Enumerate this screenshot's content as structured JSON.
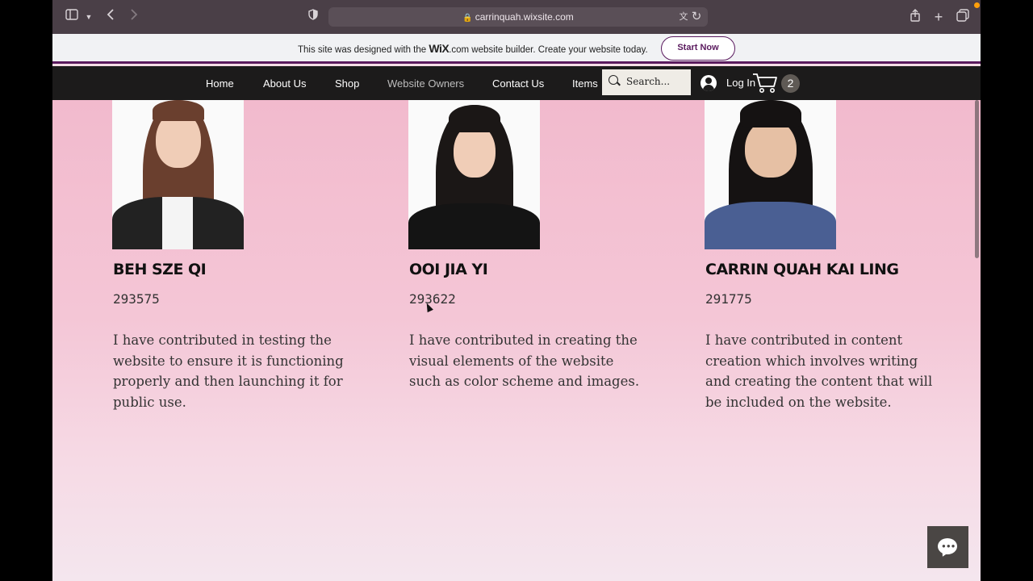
{
  "browser": {
    "url": "carrinquah.wixsite.com",
    "icons": [
      "sidebar-icon",
      "chevron-down-icon",
      "back-icon",
      "forward-icon",
      "shield-icon",
      "lock-icon",
      "translate-icon",
      "reload-icon",
      "share-icon",
      "plus-icon",
      "tabs-icon"
    ]
  },
  "wix_banner": {
    "text_before": "This site was designed with the ",
    "logo": "WiX",
    "text_after": ".com website builder. Create your website today.",
    "button": "Start Now",
    "accent": "#5a1a5e"
  },
  "nav": {
    "items": [
      "Home",
      "About Us",
      "Shop",
      "Website Owners",
      "Contact Us",
      "Items"
    ],
    "active_item": "Website Owners",
    "search_placeholder": "Search...",
    "login": "Log In",
    "cart_count": "2"
  },
  "members": [
    {
      "name": "BEH SZE QI",
      "id": "293575",
      "description": "I have contributed in testing the website to ensure it is functioning properly and then launching it for public use."
    },
    {
      "name": "OOI JIA YI",
      "id": "293622",
      "description": "I have contributed in creating the visual elements of the website such as color scheme and images."
    },
    {
      "name": "CARRIN QUAH KAI LING",
      "id": "291775",
      "description": "I have contributed in content creation which involves writing and creating the content that will be included on the website."
    }
  ],
  "chat": {
    "icon": "chat-icon"
  },
  "colors": {
    "nav_bg": "#1c1b1b",
    "content_bg": "#f2bacd",
    "wix_accent": "#5a1a5e"
  }
}
